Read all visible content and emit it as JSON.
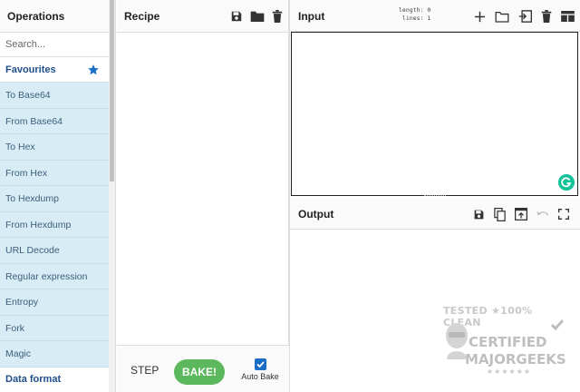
{
  "operations": {
    "title": "Operations",
    "search_placeholder": "Search...",
    "favourites_label": "Favourites",
    "items": [
      {
        "label": "To Base64"
      },
      {
        "label": "From Base64"
      },
      {
        "label": "To Hex"
      },
      {
        "label": "From Hex"
      },
      {
        "label": "To Hexdump"
      },
      {
        "label": "From Hexdump"
      },
      {
        "label": "URL Decode"
      },
      {
        "label": "Regular expression"
      },
      {
        "label": "Entropy"
      },
      {
        "label": "Fork"
      },
      {
        "label": "Magic"
      }
    ],
    "category_label": "Data format"
  },
  "recipe": {
    "title": "Recipe",
    "step_label": "STEP",
    "bake_label": "BAKE!",
    "auto_bake_label": "Auto Bake",
    "auto_bake_checked": true
  },
  "input": {
    "title": "Input",
    "length_label": "length:",
    "length_value": "0",
    "lines_label": "lines:",
    "lines_value": "1",
    "value": ""
  },
  "output": {
    "title": "Output"
  },
  "watermark": {
    "line1": "TESTED ★100% CLEAN",
    "line2": "CERTIFIED",
    "line3": "MAJORGEEKS",
    "stars": "★★★★★★"
  },
  "colors": {
    "accent": "#1a6ec7",
    "bake_button": "#5cb85c",
    "operation_bg": "#d8ecf5",
    "favourites_text": "#1f4f8a"
  },
  "icons": {
    "favourites": "star-icon",
    "recipe": [
      "save-icon",
      "folder-icon",
      "trash-icon"
    ],
    "input": [
      "plus-icon",
      "folder-icon",
      "import-icon",
      "trash-icon",
      "layout-icon"
    ],
    "output": [
      "save-icon",
      "copy-icon",
      "replace-input-icon",
      "undo-icon",
      "maximize-icon"
    ]
  }
}
